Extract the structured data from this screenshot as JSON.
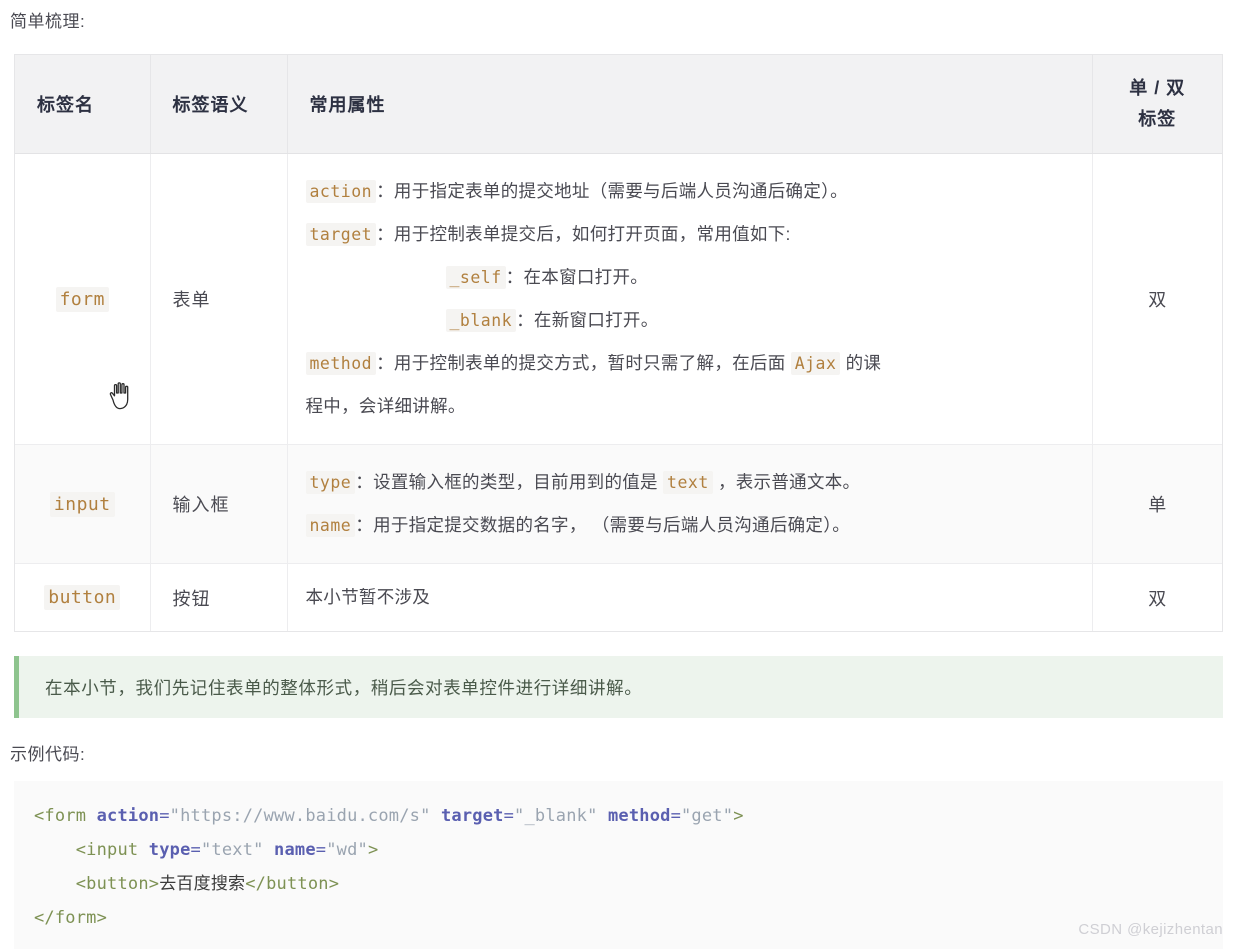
{
  "intro": "简单梳理:",
  "table": {
    "headers": {
      "tag_name": "标签名",
      "tag_semantic": "标签语义",
      "common_attrs": "常用属性",
      "pair_line1": "单 / 双",
      "pair_line2": "标签"
    },
    "rows": [
      {
        "tag": "form",
        "semantic": "表单",
        "pair": "双",
        "attrs": [
          {
            "code": "action",
            "sep": "：",
            "text": "用于指定表单的提交地址（需要与后端人员沟通后确定）。",
            "indent": false
          },
          {
            "code": "target",
            "sep": "：",
            "text": "用于控制表单提交后，如何打开页面，常用值如下:",
            "indent": false
          },
          {
            "code": "_self",
            "sep": "：",
            "text": "在本窗口打开。",
            "indent": true
          },
          {
            "code": "_blank",
            "sep": "：",
            "text": "在新窗口打开。",
            "indent": true
          },
          {
            "code": "method",
            "sep": "：",
            "text_before": "用于控制表单的提交方式，暂时只需了解，在后面 ",
            "inline_code": "Ajax",
            "text_after": " 的课",
            "indent": false
          },
          {
            "plain": "程中，会详细讲解。",
            "indent": false
          }
        ]
      },
      {
        "tag": "input",
        "semantic": "输入框",
        "pair": "单",
        "attrs": [
          {
            "code": "type",
            "sep": "：",
            "text_before": "设置输入框的类型，目前用到的值是 ",
            "inline_code": "text",
            "text_after": " ，表示普通文本。",
            "indent": false
          },
          {
            "code": "name",
            "sep": "：",
            "text": "用于指定提交数据的名字， （需要与后端人员沟通后确定）。",
            "indent": false
          }
        ]
      },
      {
        "tag": "button",
        "semantic": "按钮",
        "pair": "双",
        "plain_attr": "本小节暂不涉及"
      }
    ]
  },
  "note": "在本小节，我们先记住表单的整体形式，稍后会对表单控件进行详细讲解。",
  "sample_label": "示例代码:",
  "code": {
    "lines": [
      [
        {
          "t": "tag",
          "v": "<form"
        },
        {
          "t": "plain",
          "v": " "
        },
        {
          "t": "attr",
          "v": "action"
        },
        {
          "t": "eq",
          "v": "="
        },
        {
          "t": "str",
          "v": "\"https://www.baidu.com/s\""
        },
        {
          "t": "plain",
          "v": " "
        },
        {
          "t": "attr",
          "v": "target"
        },
        {
          "t": "eq",
          "v": "="
        },
        {
          "t": "str",
          "v": "\"_blank\""
        },
        {
          "t": "plain",
          "v": " "
        },
        {
          "t": "attr",
          "v": "method"
        },
        {
          "t": "eq",
          "v": "="
        },
        {
          "t": "str",
          "v": "\"get\""
        },
        {
          "t": "tag",
          "v": ">"
        }
      ],
      [
        {
          "t": "plain",
          "v": "    "
        },
        {
          "t": "tag",
          "v": "<input"
        },
        {
          "t": "plain",
          "v": " "
        },
        {
          "t": "attr",
          "v": "type"
        },
        {
          "t": "eq",
          "v": "="
        },
        {
          "t": "str",
          "v": "\"text\""
        },
        {
          "t": "plain",
          "v": " "
        },
        {
          "t": "attr",
          "v": "name"
        },
        {
          "t": "eq",
          "v": "="
        },
        {
          "t": "str",
          "v": "\"wd\""
        },
        {
          "t": "tag",
          "v": ">"
        }
      ],
      [
        {
          "t": "plain",
          "v": "    "
        },
        {
          "t": "tag",
          "v": "<button>"
        },
        {
          "t": "text",
          "v": "去百度搜索"
        },
        {
          "t": "tag",
          "v": "</button>"
        }
      ],
      [
        {
          "t": "tag",
          "v": "</form>"
        }
      ]
    ]
  },
  "watermark": "CSDN @kejizhentan",
  "colors": {
    "inline_code_text": "#b1803f",
    "inline_code_bg": "#f5f4f2",
    "note_bg": "#edf4ed",
    "note_border": "#8ec48e",
    "table_header_bg": "#f2f2f3",
    "code_block_bg": "#fafafa",
    "code_tag": "#7d9153",
    "code_attr": "#5a5fb0",
    "code_string": "#9aa4b0",
    "watermark": "#cfcfd4"
  }
}
